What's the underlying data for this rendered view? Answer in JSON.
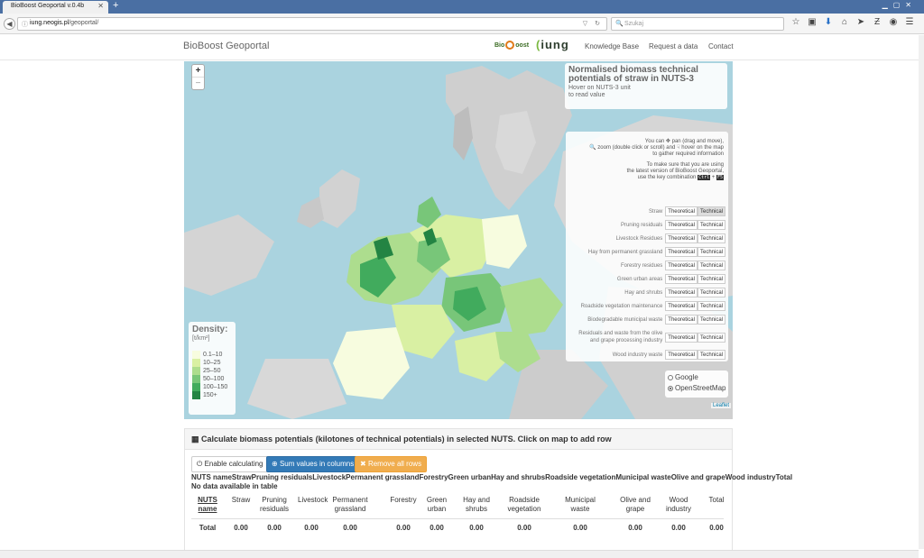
{
  "browser": {
    "tab_title": "BioBoost Geoportal v.0.4b",
    "url_host": "iung.neogis.pl",
    "url_path": "/geoportal/",
    "search_placeholder": "Szukaj"
  },
  "site": {
    "brand": "BioBoost Geoportal",
    "logo_bioboost_pre": "Bio",
    "logo_bioboost_post": "oost",
    "logo_iung": "iung",
    "menu": [
      "Knowledge Base",
      "Request a data",
      "Contact"
    ]
  },
  "map": {
    "zoom_in": "+",
    "zoom_out": "−",
    "info_title": "Normalised biomass technical potentials of straw in NUTS-3",
    "info_sub_1": "Hover on NUTS-3 unit",
    "info_sub_2": "to read value",
    "help_1": "You can ✥ pan (drag and move),",
    "help_2": "🔍 zoom (double click or scroll) and ☟ hover on the map",
    "help_3": "to gather required information",
    "help_4": "To make sure that you are using",
    "help_5": "the latest version of BioBoost Geoportal,",
    "help_6": "use the key combination",
    "key_1": "Ctrl",
    "key_plus": "+",
    "key_2": "F5",
    "theoretical_label": "Theoretical",
    "technical_label": "Technical",
    "layers": [
      "Straw",
      "Pruning residuals",
      "Livestock Residues",
      "Hay from permanent grassland",
      "Forestry residues",
      "Green urban areas",
      "Hay and shrubs",
      "Roadside vegetation maintenance",
      "Biodegradable municipal waste",
      "Residuals and waste from the olive and grape processing industry",
      "Wood industry waste"
    ],
    "basemaps": [
      "Google",
      "OpenStreetMap"
    ],
    "basemap_selected": "OpenStreetMap",
    "legend_title": "Density:",
    "legend_unit": "[t/km²]",
    "legend_items": [
      "0.1–10",
      "10–25",
      "25–50",
      "50–100",
      "100–150",
      "150+"
    ],
    "legend_colors": [
      "#f7fcdf",
      "#d9f0a3",
      "#addd8e",
      "#78c679",
      "#41ab5d",
      "#238443"
    ],
    "attribution": "Leaflet"
  },
  "calc": {
    "title": "Calculate biomass potentials (kilotones of technical potentials) in selected NUTS. Click on map to add row",
    "enable_label": "Enable calculating",
    "sum_label": "Sum values in columns",
    "remove_label": "Remove all rows",
    "header_line": "NUTS nameStrawPruning residualsLivestockPermanent grasslandForestryGreen urbanHay and shrubsRoadside vegetationMunicipal wasteOlive and grapeWood industryTotal",
    "no_data": "No data available in table",
    "columns": [
      "NUTS name",
      "Straw",
      "Pruning residuals",
      "Livestock",
      "Permanent grassland",
      "Forestry",
      "Green urban",
      "Hay and shrubs",
      "Roadside vegetation",
      "Municipal waste",
      "Olive and grape",
      "Wood industry",
      "Total"
    ],
    "total_row": [
      "Total",
      "0.00",
      "0.00",
      "0.00",
      "0.00",
      "0.00",
      "0.00",
      "0.00",
      "0.00",
      "0.00",
      "0.00",
      "0.00",
      "0.00"
    ]
  }
}
